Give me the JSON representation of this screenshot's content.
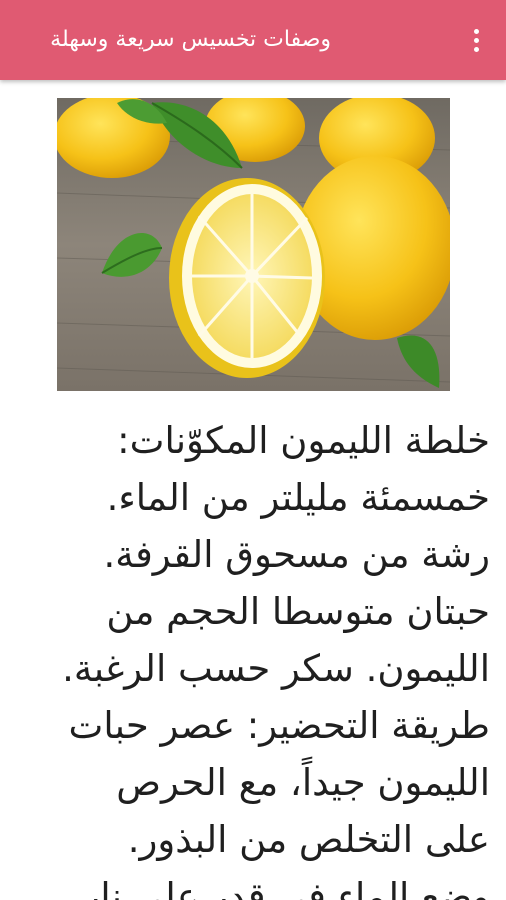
{
  "appbar": {
    "title": "وصفات تخسيس سريعة وسهلة",
    "menu_icon": "overflow-menu-icon",
    "color": "#e05a72"
  },
  "hero": {
    "image": "lemons-photo"
  },
  "article": {
    "lines": [
      "خلطة الليمون المكوّنات:",
      "خمسمئة مليلتر من الماء.",
      "رشة من مسحوق القرفة.",
      "حبتان متوسطا الحجم من",
      "الليمون. سكر حسب الرغبة.",
      "طريقة التحضير: عصر حبات",
      "الليمون جيداً، مع الحرص",
      "على التخلص من البذور.",
      "وضع الماء في قدر على نار"
    ]
  }
}
